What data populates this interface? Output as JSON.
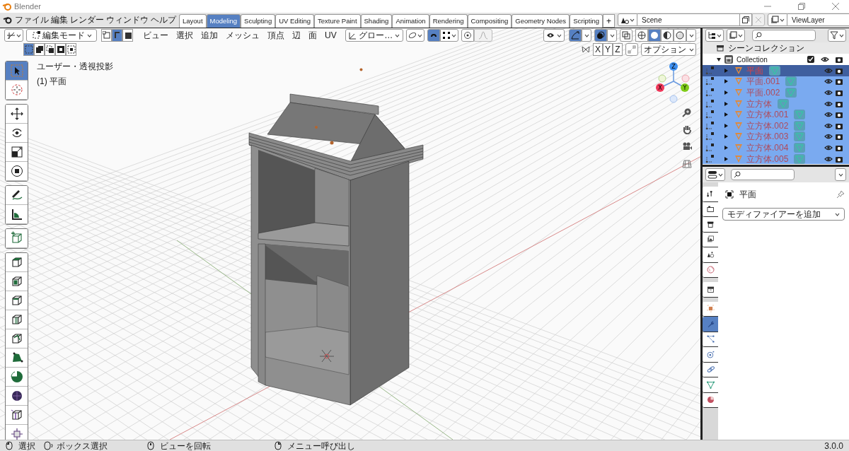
{
  "window": {
    "title": "Blender"
  },
  "menu": [
    "ファイル",
    "編集",
    "レンダー",
    "ウィンドウ",
    "ヘルプ"
  ],
  "workspaces": [
    {
      "label": "Layout",
      "selected": false
    },
    {
      "label": "Modeling",
      "selected": true
    },
    {
      "label": "Sculpting",
      "selected": false
    },
    {
      "label": "UV Editing",
      "selected": false
    },
    {
      "label": "Texture Paint",
      "selected": false
    },
    {
      "label": "Shading",
      "selected": false
    },
    {
      "label": "Animation",
      "selected": false
    },
    {
      "label": "Rendering",
      "selected": false
    },
    {
      "label": "Compositing",
      "selected": false
    },
    {
      "label": "Geometry Nodes",
      "selected": false
    },
    {
      "label": "Scripting",
      "selected": false
    }
  ],
  "add_workspace": "+",
  "scene": {
    "name": "Scene"
  },
  "view_layer": {
    "name": "ViewLayer"
  },
  "viewport": {
    "mode": "編集モード",
    "select_modes": [
      {
        "kind": "vertex",
        "selected": false
      },
      {
        "kind": "edge",
        "selected": true
      },
      {
        "kind": "face",
        "selected": false
      }
    ],
    "menus": [
      "ビュー",
      "選択",
      "追加",
      "メッシュ",
      "頂点",
      "辺",
      "面",
      "UV"
    ],
    "orientation": "グロー…",
    "snap": true,
    "proportional_editing": false,
    "gizmos": true,
    "overlays": true,
    "xray": false,
    "shading": [
      {
        "kind": "wireframe",
        "selected": false
      },
      {
        "kind": "solid",
        "selected": true
      },
      {
        "kind": "material",
        "selected": false
      },
      {
        "kind": "rendered",
        "selected": false
      }
    ],
    "box_select_modes": [
      {
        "kind": "new",
        "selected": true
      },
      {
        "kind": "extend",
        "selected": false
      },
      {
        "kind": "subtract",
        "selected": false
      },
      {
        "kind": "invert",
        "selected": false
      },
      {
        "kind": "intersect",
        "selected": false
      }
    ],
    "mirror_axes": [
      {
        "label": "X",
        "selected": false
      },
      {
        "label": "Y",
        "selected": false
      },
      {
        "label": "Z",
        "selected": false
      }
    ],
    "options": "オプション",
    "view_name": "ユーザー・透視投影",
    "object_info": "(1) 平面",
    "gizmo_axes": [
      "Z",
      "X",
      "Y"
    ],
    "tools": [
      {
        "kind": "select",
        "selected": true
      },
      {
        "kind": "cursor",
        "selected": false
      },
      {
        "kind": "move",
        "selected": false
      },
      {
        "kind": "rotate",
        "selected": false
      },
      {
        "kind": "scale",
        "selected": false
      },
      {
        "kind": "transform",
        "selected": false
      },
      {
        "kind": "annotate",
        "selected": false
      },
      {
        "kind": "measure",
        "selected": false
      },
      {
        "kind": "add-cube",
        "selected": false
      },
      {
        "kind": "extrude",
        "selected": false
      },
      {
        "kind": "inset",
        "selected": false
      },
      {
        "kind": "bevel",
        "selected": false
      },
      {
        "kind": "loop-cut",
        "selected": false
      },
      {
        "kind": "knife",
        "selected": false
      },
      {
        "kind": "poly-build",
        "selected": false
      },
      {
        "kind": "spin",
        "selected": false
      },
      {
        "kind": "smooth",
        "selected": false
      },
      {
        "kind": "edge-slide",
        "selected": false
      },
      {
        "kind": "shrink",
        "selected": false
      }
    ]
  },
  "outliner": {
    "title": "シーンコレクション",
    "collection": {
      "name": "Collection",
      "checked": true
    },
    "items": [
      {
        "name": "平面",
        "selected": true,
        "active": true
      },
      {
        "name": "平面.001",
        "selected": true,
        "active": false
      },
      {
        "name": "平面.002",
        "selected": true,
        "active": false
      },
      {
        "name": "立方体",
        "selected": true,
        "active": false
      },
      {
        "name": "立方体.001",
        "selected": true,
        "active": false
      },
      {
        "name": "立方体.002",
        "selected": true,
        "active": false
      },
      {
        "name": "立方体.003",
        "selected": true,
        "active": false
      },
      {
        "name": "立方体.004",
        "selected": true,
        "active": false
      },
      {
        "name": "立方体.005",
        "selected": true,
        "active": false
      }
    ]
  },
  "properties": {
    "object_name": "平面",
    "add_modifier": "モディファイアーを追加",
    "tabs": [
      {
        "kind": "tool",
        "selected": false
      },
      {
        "kind": "render",
        "selected": false
      },
      {
        "kind": "output",
        "selected": false
      },
      {
        "kind": "view-layer",
        "selected": false
      },
      {
        "kind": "scene",
        "selected": false
      },
      {
        "kind": "world",
        "selected": false
      },
      {
        "kind": "collection",
        "selected": false
      },
      {
        "kind": "object",
        "selected": false
      },
      {
        "kind": "modifier",
        "selected": true
      },
      {
        "kind": "particles",
        "selected": false
      },
      {
        "kind": "physics",
        "selected": false
      },
      {
        "kind": "constraints",
        "selected": false
      },
      {
        "kind": "data",
        "selected": false
      },
      {
        "kind": "material",
        "selected": false
      }
    ]
  },
  "status_bar": {
    "hints": [
      {
        "kind": "left-click",
        "label": "選択"
      },
      {
        "kind": "left-drag",
        "label": "ボックス選択"
      },
      {
        "kind": "middle-drag",
        "label": "ビューを回転"
      },
      {
        "kind": "right-click",
        "label": "メニュー呼び出し"
      }
    ],
    "version": "3.0.0"
  }
}
